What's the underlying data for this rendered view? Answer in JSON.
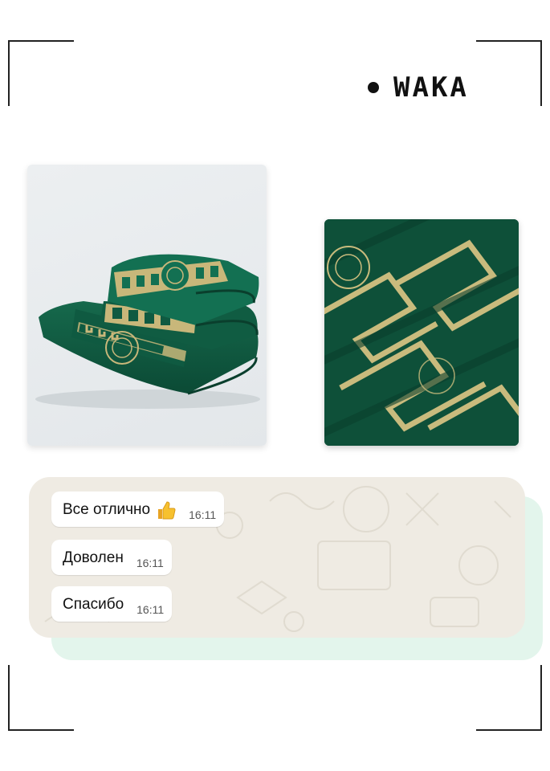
{
  "brand": {
    "name": "WAKA"
  },
  "photos": [
    {
      "subject": "folded-green-towels"
    },
    {
      "subject": "green-towel-closeup"
    }
  ],
  "chat": {
    "messages": [
      {
        "text": "Все отлично",
        "emoji": "thumbs-up-icon",
        "time": "16:11"
      },
      {
        "text": "Доволен",
        "time": "16:11"
      },
      {
        "text": "Спасибо",
        "time": "16:11"
      }
    ]
  },
  "colors": {
    "towel_green": "#0f5a41",
    "gold": "#c8b77a",
    "chat_bg": "#efebe3",
    "accent_back": "#e3f5ec",
    "bubble": "#ffffff"
  }
}
